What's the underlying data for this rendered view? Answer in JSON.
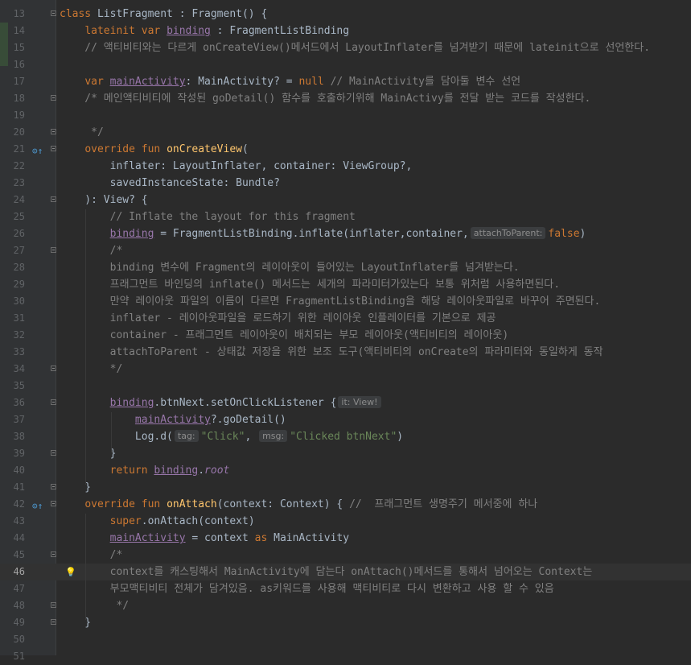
{
  "editor": {
    "current_line": "46",
    "lines": [
      {
        "no": "13",
        "parts": [
          {
            "t": "class ",
            "c": "kw"
          },
          {
            "t": "ListFragment : Fragment() {"
          }
        ]
      },
      {
        "no": "14",
        "parts": [
          {
            "t": "    "
          },
          {
            "t": "lateinit var ",
            "c": "kw"
          },
          {
            "t": "binding",
            "c": "prop ul"
          },
          {
            "t": " : FragmentListBinding"
          }
        ]
      },
      {
        "no": "15",
        "parts": [
          {
            "t": "    // 액티비티와는 다르게 onCreateView()메서드에서 LayoutInflater를 넘겨받기 때문에 lateinit으로 선언한다.",
            "c": "cm"
          }
        ]
      },
      {
        "no": "16",
        "parts": []
      },
      {
        "no": "17",
        "parts": [
          {
            "t": "    "
          },
          {
            "t": "var ",
            "c": "kw"
          },
          {
            "t": "mainActivity",
            "c": "prop ul"
          },
          {
            "t": ": MainActivity? = "
          },
          {
            "t": "null",
            "c": "kw"
          },
          {
            "t": " // MainActivity를 담아둘 변수 선언",
            "c": "cm"
          }
        ]
      },
      {
        "no": "18",
        "parts": [
          {
            "t": "    /* 메인액티비티에 작성된 goDetail() 함수를 호출하기위해 MainActivy를 전달 받는 코드를 작성한다.",
            "c": "cm"
          }
        ]
      },
      {
        "no": "19",
        "parts": []
      },
      {
        "no": "20",
        "parts": [
          {
            "t": "     */",
            "c": "cm"
          }
        ]
      },
      {
        "no": "21",
        "icon": "⊙↑",
        "parts": [
          {
            "t": "    "
          },
          {
            "t": "override fun ",
            "c": "kw"
          },
          {
            "t": "onCreateView",
            "c": "fn"
          },
          {
            "t": "("
          }
        ]
      },
      {
        "no": "22",
        "parts": [
          {
            "t": "        inflater: LayoutInflater, container: ViewGroup?,"
          }
        ]
      },
      {
        "no": "23",
        "parts": [
          {
            "t": "        savedInstanceState: Bundle?"
          }
        ]
      },
      {
        "no": "24",
        "parts": [
          {
            "t": "    ): View? {"
          }
        ]
      },
      {
        "no": "25",
        "parts": [
          {
            "t": "        // Inflate the layout for this fragment",
            "c": "cm"
          }
        ]
      },
      {
        "no": "26",
        "parts": [
          {
            "t": "        "
          },
          {
            "t": "binding",
            "c": "prop ul"
          },
          {
            "t": " = FragmentListBinding.inflate(inflater,container,"
          },
          {
            "hint": "attachToParent:"
          },
          {
            "t": "false",
            "c": "kw"
          },
          {
            "t": ")"
          }
        ]
      },
      {
        "no": "27",
        "parts": [
          {
            "t": "        /*",
            "c": "cm"
          }
        ]
      },
      {
        "no": "28",
        "parts": [
          {
            "t": "        binding 변수에 Fragment의 레이아웃이 들어있는 LayoutInflater를 넘겨받는다.",
            "c": "cm"
          }
        ]
      },
      {
        "no": "29",
        "parts": [
          {
            "t": "        프래그먼트 바인딩의 inflate() 메서드는 세개의 파라미터가있는다 보통 위처럼 사용하면된다.",
            "c": "cm"
          }
        ]
      },
      {
        "no": "30",
        "parts": [
          {
            "t": "        만약 레이아웃 파일의 이름이 다르면 FragmentListBinding을 해당 레이아웃파일로 바꾸어 주면된다.",
            "c": "cm"
          }
        ]
      },
      {
        "no": "31",
        "parts": [
          {
            "t": "        inflater - 레이아웃파일을 로드하기 위한 레이아웃 인플레이터를 기본으로 제공",
            "c": "cm"
          }
        ]
      },
      {
        "no": "32",
        "parts": [
          {
            "t": "        container - 프래그먼트 레이아웃이 배치되는 부모 레이아웃(액티비티의 레이아웃)",
            "c": "cm"
          }
        ]
      },
      {
        "no": "33",
        "parts": [
          {
            "t": "        attachToParent - 상태값 저장을 위한 보조 도구(액티비티의 onCreate의 파라미터와 동일하게 동작",
            "c": "cm"
          }
        ]
      },
      {
        "no": "34",
        "parts": [
          {
            "t": "        */",
            "c": "cm"
          }
        ]
      },
      {
        "no": "35",
        "parts": []
      },
      {
        "no": "36",
        "parts": [
          {
            "t": "        "
          },
          {
            "t": "binding",
            "c": "prop ul"
          },
          {
            "t": ".btnNext.setOnClickListener {"
          },
          {
            "hint": "it: View!"
          }
        ]
      },
      {
        "no": "37",
        "parts": [
          {
            "t": "            "
          },
          {
            "t": "mainActivity",
            "c": "prop ul"
          },
          {
            "t": "?.goDetail()"
          }
        ]
      },
      {
        "no": "38",
        "parts": [
          {
            "t": "            Log.d("
          },
          {
            "hint": "tag:"
          },
          {
            "t": "\"Click\"",
            "c": "str"
          },
          {
            "t": ", "
          },
          {
            "hint": "msg:"
          },
          {
            "t": "\"Clicked btnNext\"",
            "c": "str"
          },
          {
            "t": ")"
          }
        ]
      },
      {
        "no": "39",
        "parts": [
          {
            "t": "        }"
          }
        ]
      },
      {
        "no": "40",
        "parts": [
          {
            "t": "        "
          },
          {
            "t": "return ",
            "c": "kw"
          },
          {
            "t": "binding",
            "c": "prop ul"
          },
          {
            "t": "."
          },
          {
            "t": "root",
            "c": "prop it"
          }
        ]
      },
      {
        "no": "41",
        "parts": [
          {
            "t": "    }"
          }
        ]
      },
      {
        "no": "42",
        "icon": "⊙↑",
        "parts": [
          {
            "t": "    "
          },
          {
            "t": "override fun ",
            "c": "kw"
          },
          {
            "t": "onAttach",
            "c": "fn"
          },
          {
            "t": "(context: Context) { "
          },
          {
            "t": "//  프래그먼트 생명주기 메서중에 하나",
            "c": "cm"
          }
        ]
      },
      {
        "no": "43",
        "parts": [
          {
            "t": "        "
          },
          {
            "t": "super",
            "c": "kw"
          },
          {
            "t": ".onAttach(context)"
          }
        ]
      },
      {
        "no": "44",
        "parts": [
          {
            "t": "        "
          },
          {
            "t": "mainActivity",
            "c": "prop ul"
          },
          {
            "t": " = context "
          },
          {
            "t": "as",
            "c": "kw"
          },
          {
            "t": " MainActivity"
          }
        ]
      },
      {
        "no": "45",
        "parts": [
          {
            "t": "        /*",
            "c": "cm"
          }
        ]
      },
      {
        "no": "46",
        "bulb": true,
        "parts": [
          {
            "t": "        context를 캐스팅해서 MainActivity에 담는다 onAttach()메서드를 통해서 넘어오는 Context는",
            "c": "cm"
          }
        ]
      },
      {
        "no": "47",
        "parts": [
          {
            "t": "        부모맥티비티 전체가 담겨있음. as키워드를 사용해 맥티비티로 다시 변환하고 사용 할 수 있음",
            "c": "cm"
          }
        ]
      },
      {
        "no": "48",
        "parts": [
          {
            "t": "         */",
            "c": "cm"
          }
        ]
      },
      {
        "no": "49",
        "parts": [
          {
            "t": "    }"
          }
        ]
      },
      {
        "no": "50",
        "parts": []
      },
      {
        "no": "51",
        "parts": []
      }
    ],
    "fold_lines": [
      "13",
      "18",
      "20",
      "21",
      "24",
      "27",
      "34",
      "36",
      "39",
      "41",
      "42",
      "45",
      "48",
      "49"
    ]
  }
}
